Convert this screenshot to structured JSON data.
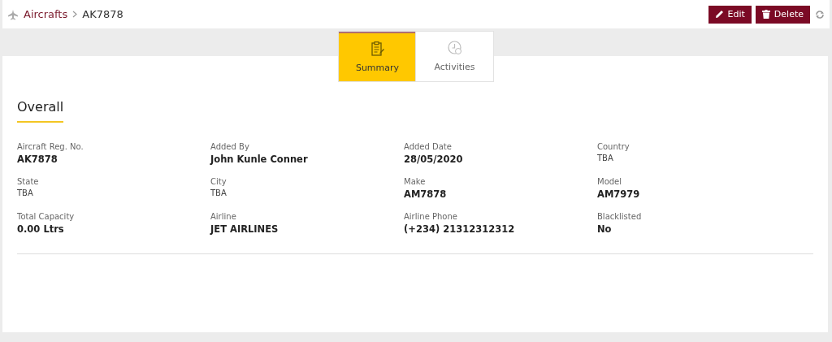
{
  "breadcrumb": {
    "parent": "Aircrafts",
    "current": "AK7878"
  },
  "actions": [
    {
      "kind": "edit",
      "label": "Edit"
    },
    {
      "kind": "delete",
      "label": "Delete"
    }
  ],
  "tabs": [
    {
      "label": "Summary",
      "kind": "summary",
      "selected": true
    },
    {
      "label": "Activities",
      "kind": "activities",
      "selected": false
    }
  ],
  "section": {
    "title": "Overall"
  },
  "fields": [
    {
      "label": "Aircraft Reg. No.",
      "value": "AK7878",
      "kind": "strong"
    },
    {
      "label": "Added By",
      "value": "John Kunle Conner",
      "kind": "strong"
    },
    {
      "label": "Added Date",
      "value": "28/05/2020",
      "kind": "strong"
    },
    {
      "label": "Country",
      "value": "TBA",
      "kind": "plain"
    },
    {
      "label": "State",
      "value": "TBA",
      "kind": "plain"
    },
    {
      "label": "City",
      "value": "TBA",
      "kind": "plain"
    },
    {
      "label": "Make",
      "value": "AM7878",
      "kind": "strong"
    },
    {
      "label": "Model",
      "value": "AM7979",
      "kind": "strong"
    },
    {
      "label": "Total Capacity",
      "value": "0.00 Ltrs",
      "kind": "strong"
    },
    {
      "label": "Airline",
      "value": "JET AIRLINES",
      "kind": "strong"
    },
    {
      "label": "Airline Phone",
      "value": "(+234) 21312312312",
      "kind": "strong"
    },
    {
      "label": "Blacklisted",
      "value": "No",
      "kind": "strong"
    }
  ]
}
